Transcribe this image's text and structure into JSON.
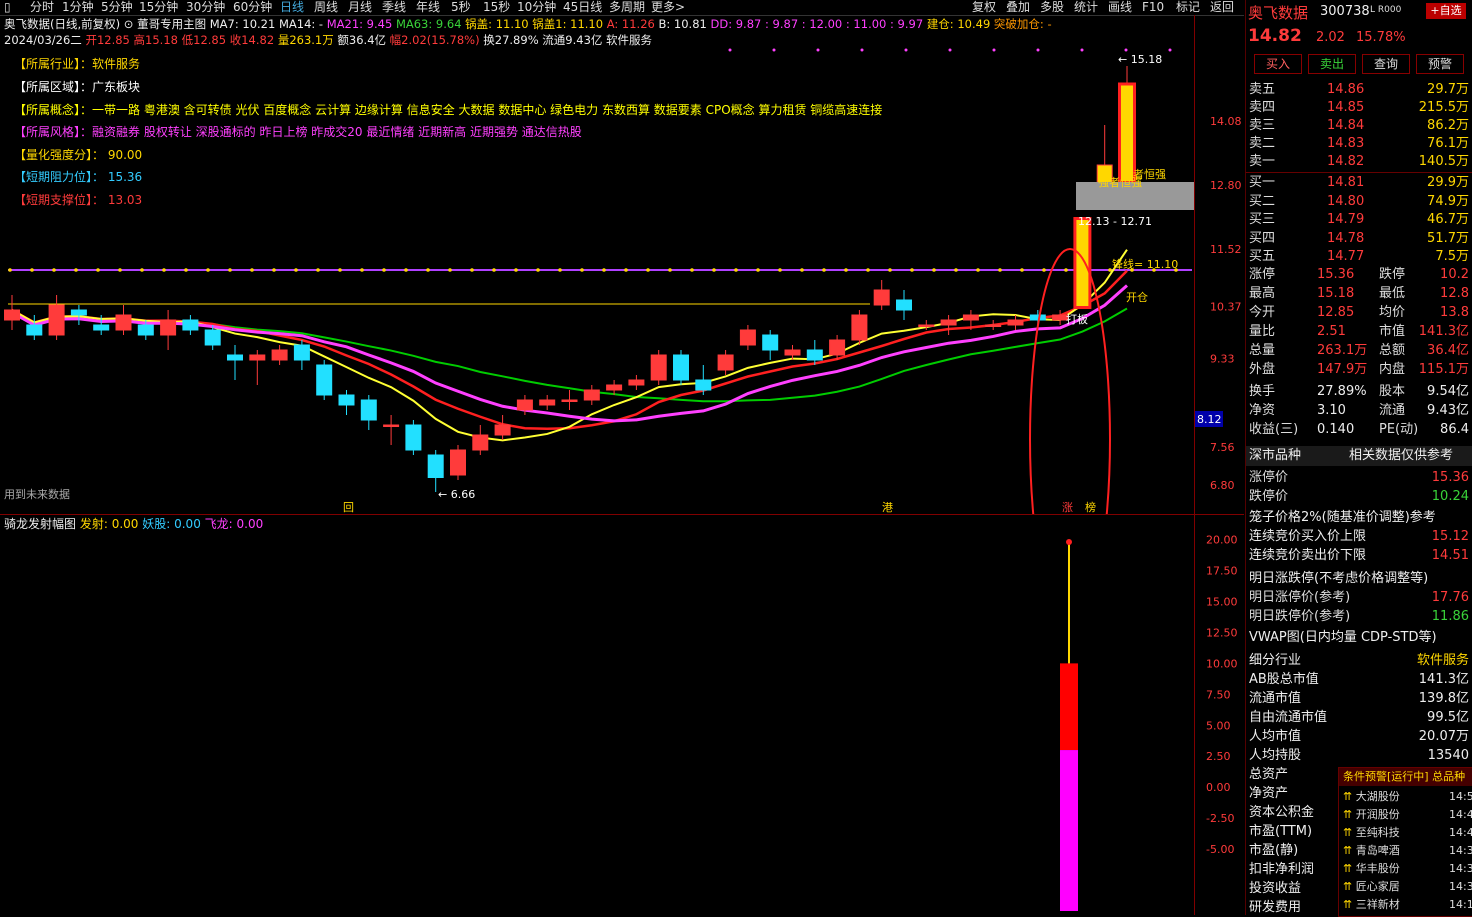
{
  "toolbar": {
    "periods": [
      "分时",
      "1分钟",
      "5分钟",
      "15分钟",
      "30分钟",
      "60分钟",
      "日线",
      "周线",
      "月线",
      "季线",
      "年线",
      "5秒",
      "15秒",
      "10分钟",
      "45日线",
      "多周期",
      "更多>"
    ],
    "selected": "日线",
    "right": [
      "复权",
      "叠加",
      "多股",
      "统计",
      "画线",
      "F10",
      "标记",
      "返回"
    ]
  },
  "info1": {
    "title": "奥飞数据(日线,前复权)",
    "template": "董哥专用主图",
    "ma7": "MA7: 10.21",
    "ma14": "MA14: -",
    "ma21": "MA21: 9.45",
    "ma63": "MA63: 9.64",
    "guogai": "锅盖: 11.10",
    "guogai1": "锅盖1: 11.10",
    "a": "A: 11.26",
    "b": "B: 10.81",
    "dd": "DD: 9.87 : 9.87 : 12.00 : 11.00 : 9.97",
    "jiancang": "建仓: 10.49",
    "tupo": "突破加仓: -"
  },
  "info2": {
    "date": "2024/03/26二",
    "open": "开12.85",
    "high": "高15.18",
    "low": "低12.85",
    "close": "收14.82",
    "vol": "量263.1万",
    "amount": "额36.4亿",
    "amp": "幅2.02(15.78%)",
    "turnover": "换27.89%",
    "float": "流通9.43亿",
    "sector": "软件服务"
  },
  "labels": {
    "industry": "【所属行业】：软件服务",
    "region": "【所属区域】：广东板块",
    "concept": "【所属概念】：一带一路 粤港澳 含可转债 光伏 百度概念 云计算 边缘计算 信息安全 大数据 数据中心 绿色电力 东数西算 数据要素 CPO概念 算力租赁 铜缆高速连接",
    "style": "【所属风格】：融资融券 股权转让 深股通标的 昨日上榜 昨成交20 最近情绪 近期新高 近期强势 通达信热股",
    "quant": "【量化强度分】： 90.00",
    "resistance": "【短期阻力位】： 15.36",
    "support": "【短期支撑位】： 13.03"
  },
  "main_axis": [
    "14.08",
    "12.80",
    "11.52",
    "10.37",
    "9.33",
    "8.12",
    "7.56",
    "6.80"
  ],
  "current_price_tag": "8.12",
  "annotations": {
    "high": "15.18",
    "low": "6.66",
    "zone": "12.13 - 12.71",
    "strong1": "强者恒强",
    "strong2": "强者恒强",
    "pot_line": "锋线= 11.10",
    "kaicang": "开仓",
    "daban": "打板",
    "future": "用到未来数据",
    "marks": [
      "回",
      "港",
      "涨",
      "榜"
    ]
  },
  "sub": {
    "title": "骑龙发射幅图",
    "fashe": "发射: 0.00",
    "yaogu": "妖股: 0.00",
    "feilong": "飞龙: 0.00",
    "axis": [
      "20.00",
      "17.50",
      "15.00",
      "12.50",
      "10.00",
      "7.50",
      "5.00",
      "2.50",
      "0.00",
      "-2.50",
      "-5.00"
    ]
  },
  "right_panel": {
    "name": "奥飞数据",
    "code": "300738",
    "tag": "L R000",
    "self_btn": "+自选",
    "price": "14.82",
    "change": "2.02",
    "pct": "15.78%",
    "buttons": [
      "买入",
      "卖出",
      "查询",
      "预警"
    ],
    "asks": [
      {
        "label": "卖五",
        "price": "14.86",
        "vol": "29.7万"
      },
      {
        "label": "卖四",
        "price": "14.85",
        "vol": "215.5万"
      },
      {
        "label": "卖三",
        "price": "14.84",
        "vol": "86.2万"
      },
      {
        "label": "卖二",
        "price": "14.83",
        "vol": "76.1万"
      },
      {
        "label": "卖一",
        "price": "14.82",
        "vol": "140.5万"
      }
    ],
    "bids": [
      {
        "label": "买一",
        "price": "14.81",
        "vol": "29.9万"
      },
      {
        "label": "买二",
        "price": "14.80",
        "vol": "74.9万"
      },
      {
        "label": "买三",
        "price": "14.79",
        "vol": "46.7万"
      },
      {
        "label": "买四",
        "price": "14.78",
        "vol": "51.7万"
      },
      {
        "label": "买五",
        "price": "14.77",
        "vol": "7.5万"
      }
    ],
    "stats": [
      [
        "涨停",
        "15.36",
        "跌停",
        "10.2"
      ],
      [
        "最高",
        "15.18",
        "最低",
        "12.8"
      ],
      [
        "今开",
        "12.85",
        "均价",
        "13.8"
      ],
      [
        "量比",
        "2.51",
        "市值",
        "141.3亿"
      ],
      [
        "总量",
        "263.1万",
        "总额",
        "36.4亿"
      ],
      [
        "外盘",
        "147.9万",
        "内盘",
        "115.1万"
      ]
    ],
    "stats2": [
      [
        "换手",
        "27.89%",
        "股本",
        "9.54亿"
      ],
      [
        "净资",
        "3.10",
        "流通",
        "9.43亿"
      ],
      [
        "收益(三)",
        "0.140",
        "PE(动)",
        "86.4"
      ]
    ],
    "sz": {
      "title": "深市品种",
      "note": "相关数据仅供参考"
    },
    "limit_up_label": "涨停价",
    "limit_up": "15.36",
    "limit_down_label": "跌停价",
    "limit_down": "10.24",
    "cage": "笼子价格2%(随基准价调整)参考",
    "cbuy_label": "连续竞价买入价上限",
    "cbuy": "15.12",
    "csell_label": "连续竞价卖出价下限",
    "csell": "14.51",
    "tomorrow": "明日涨跌停(不考虑价格调整等)",
    "tup_label": "明日涨停价(参考)",
    "tup": "17.76",
    "tdown_label": "明日跌停价(参考)",
    "tdown": "11.86",
    "vwap": "VWAP图(日内均量 CDP-STD等)",
    "fund": [
      [
        "细分行业",
        "软件服务"
      ],
      [
        "AB股总市值",
        "141.3亿"
      ],
      [
        "流通市值",
        "139.8亿"
      ],
      [
        "自由流通市值",
        "99.5亿"
      ],
      [
        "人均市值",
        "20.07万"
      ],
      [
        "人均持股",
        "13540"
      ],
      [
        "总资产",
        ""
      ],
      [
        "净资产",
        ""
      ],
      [
        "资本公积金",
        ""
      ],
      [
        "市盈(TTM)",
        ""
      ],
      [
        "市盈(静)",
        ""
      ],
      [
        "扣非净利润",
        ""
      ],
      [
        "投资收益",
        ""
      ],
      [
        "研发费用",
        ""
      ]
    ],
    "alert_title": "条件预警[运行中] 总品种",
    "alerts": [
      {
        "name": "大湖股份",
        "time": "14:5"
      },
      {
        "name": "开润股份",
        "time": "14:4"
      },
      {
        "name": "至纯科技",
        "time": "14:4"
      },
      {
        "name": "青岛啤酒",
        "time": "14:3"
      },
      {
        "name": "华丰股份",
        "time": "14:3"
      },
      {
        "name": "匠心家居",
        "time": "14:3"
      },
      {
        "name": "三祥新材",
        "time": "14:1"
      }
    ]
  },
  "chart_data": {
    "type": "candlestick",
    "ylim": [
      6.4,
      15.6
    ],
    "candles": [
      {
        "o": 10.1,
        "c": 10.3,
        "h": 10.6,
        "l": 9.9
      },
      {
        "o": 10.0,
        "c": 9.8,
        "h": 10.2,
        "l": 9.7
      },
      {
        "o": 9.8,
        "c": 10.4,
        "h": 10.6,
        "l": 9.7
      },
      {
        "o": 10.3,
        "c": 10.2,
        "h": 10.4,
        "l": 10.0
      },
      {
        "o": 10.0,
        "c": 9.9,
        "h": 10.2,
        "l": 9.8
      },
      {
        "o": 9.9,
        "c": 10.2,
        "h": 10.4,
        "l": 9.8
      },
      {
        "o": 10.0,
        "c": 9.8,
        "h": 10.1,
        "l": 9.7
      },
      {
        "o": 9.8,
        "c": 10.1,
        "h": 10.3,
        "l": 9.5
      },
      {
        "o": 10.1,
        "c": 9.9,
        "h": 10.2,
        "l": 9.8
      },
      {
        "o": 9.9,
        "c": 9.6,
        "h": 10.0,
        "l": 9.5
      },
      {
        "o": 9.4,
        "c": 9.3,
        "h": 9.6,
        "l": 8.9
      },
      {
        "o": 9.3,
        "c": 9.4,
        "h": 9.5,
        "l": 8.8
      },
      {
        "o": 9.3,
        "c": 9.5,
        "h": 9.6,
        "l": 9.2
      },
      {
        "o": 9.6,
        "c": 9.3,
        "h": 9.7,
        "l": 9.1
      },
      {
        "o": 9.2,
        "c": 8.6,
        "h": 9.3,
        "l": 8.5
      },
      {
        "o": 8.6,
        "c": 8.4,
        "h": 8.7,
        "l": 8.2
      },
      {
        "o": 8.5,
        "c": 8.1,
        "h": 8.6,
        "l": 7.9
      },
      {
        "o": 8.0,
        "c": 8.0,
        "h": 8.2,
        "l": 7.6
      },
      {
        "o": 8.0,
        "c": 7.5,
        "h": 8.1,
        "l": 7.4
      },
      {
        "o": 7.4,
        "c": 6.95,
        "h": 7.5,
        "l": 6.66
      },
      {
        "o": 7.0,
        "c": 7.5,
        "h": 7.6,
        "l": 6.9
      },
      {
        "o": 7.5,
        "c": 7.8,
        "h": 8.0,
        "l": 7.4
      },
      {
        "o": 7.8,
        "c": 8.0,
        "h": 8.2,
        "l": 7.7
      },
      {
        "o": 8.3,
        "c": 8.5,
        "h": 8.6,
        "l": 8.2
      },
      {
        "o": 8.4,
        "c": 8.5,
        "h": 8.6,
        "l": 8.3
      },
      {
        "o": 8.5,
        "c": 8.5,
        "h": 8.7,
        "l": 8.3
      },
      {
        "o": 8.5,
        "c": 8.7,
        "h": 8.8,
        "l": 8.4
      },
      {
        "o": 8.7,
        "c": 8.8,
        "h": 8.9,
        "l": 8.6
      },
      {
        "o": 8.8,
        "c": 8.9,
        "h": 9.0,
        "l": 8.7
      },
      {
        "o": 8.9,
        "c": 9.4,
        "h": 9.5,
        "l": 8.8
      },
      {
        "o": 9.4,
        "c": 8.9,
        "h": 9.5,
        "l": 8.8
      },
      {
        "o": 8.9,
        "c": 8.7,
        "h": 9.2,
        "l": 8.6
      },
      {
        "o": 9.1,
        "c": 9.4,
        "h": 9.5,
        "l": 9.0
      },
      {
        "o": 9.6,
        "c": 9.9,
        "h": 10.0,
        "l": 9.5
      },
      {
        "o": 9.8,
        "c": 9.5,
        "h": 9.9,
        "l": 9.3
      },
      {
        "o": 9.4,
        "c": 9.5,
        "h": 9.6,
        "l": 9.3
      },
      {
        "o": 9.5,
        "c": 9.3,
        "h": 9.7,
        "l": 9.2
      },
      {
        "o": 9.4,
        "c": 9.7,
        "h": 9.8,
        "l": 9.3
      },
      {
        "o": 9.7,
        "c": 10.2,
        "h": 10.3,
        "l": 9.6
      },
      {
        "o": 10.4,
        "c": 10.7,
        "h": 10.9,
        "l": 10.3
      },
      {
        "o": 10.5,
        "c": 10.3,
        "h": 10.7,
        "l": 10.1
      },
      {
        "o": 10.0,
        "c": 10.0,
        "h": 10.1,
        "l": 9.9
      },
      {
        "o": 10.0,
        "c": 10.1,
        "h": 10.2,
        "l": 9.8
      },
      {
        "o": 10.1,
        "c": 10.2,
        "h": 10.3,
        "l": 9.9
      },
      {
        "o": 10.0,
        "c": 10.0,
        "h": 10.1,
        "l": 9.9
      },
      {
        "o": 10.0,
        "c": 10.1,
        "h": 10.2,
        "l": 9.9
      },
      {
        "o": 10.2,
        "c": 10.1,
        "h": 10.3,
        "l": 10.0
      },
      {
        "o": 10.1,
        "c": 10.2,
        "h": 10.3,
        "l": 10.0
      },
      {
        "o": 10.35,
        "c": 12.13,
        "h": 12.13,
        "l": 10.35
      },
      {
        "o": 12.85,
        "c": 13.2,
        "h": 14.0,
        "l": 12.85
      },
      {
        "o": 12.85,
        "c": 14.82,
        "h": 15.18,
        "l": 12.85
      }
    ],
    "sub_bars": [
      {
        "from": 10.0,
        "to": 3.0,
        "color": "#ff0000"
      },
      {
        "from": 3.0,
        "to": -10.0,
        "color": "#ff00ff"
      }
    ],
    "sub_ylim": [
      -10,
      21.5
    ]
  }
}
